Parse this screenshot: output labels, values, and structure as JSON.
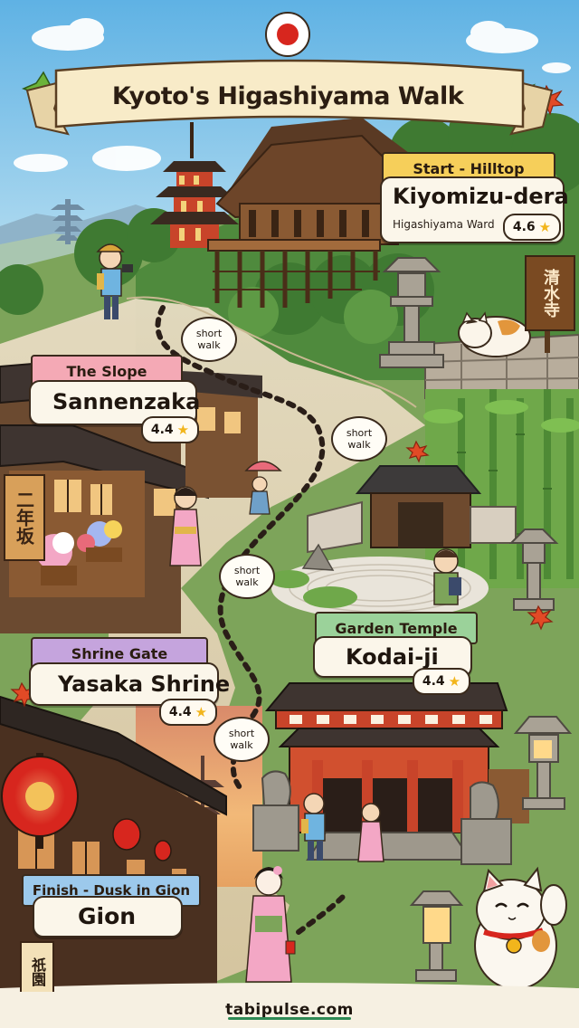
{
  "header": {
    "title": "Kyoto's Higashiyama Walk"
  },
  "stops": [
    {
      "ribbon": "Start - Hilltop",
      "name": "Kiyomizu-dera",
      "sub": "Higashiyama Ward",
      "rating": "4.6"
    },
    {
      "ribbon": "The Slope",
      "name": "Sannenzaka",
      "rating": "4.4"
    },
    {
      "ribbon": "Garden Temple",
      "name": "Kodai-ji",
      "rating": "4.4"
    },
    {
      "ribbon": "Shrine Gate",
      "name": "Yasaka Shrine",
      "rating": "4.4"
    },
    {
      "ribbon": "Finish - Dusk in Gion",
      "name": "Gion"
    }
  ],
  "bubbles": [
    "short walk",
    "short walk",
    "short walk",
    "short walk"
  ],
  "signs": {
    "kiyomizu": "清水寺",
    "ninenzaka": "二年坂",
    "gion": "祇園"
  },
  "footer": {
    "site": "tabipulse.com"
  },
  "colors": {
    "sky": "#7ec3e8",
    "ribbon_start": "#f6cf5a",
    "ribbon_slope": "#f4a9b5",
    "ribbon_garden": "#9bd29a",
    "ribbon_shrine": "#c5a4dd",
    "ribbon_finish": "#9cc9ec",
    "temple_red": "#c8442a",
    "flag_red": "#d7261e"
  },
  "icons": [
    "maple-leaf-icon",
    "star-icon",
    "japan-flag-icon",
    "lucky-cat-icon",
    "lantern-icon"
  ]
}
